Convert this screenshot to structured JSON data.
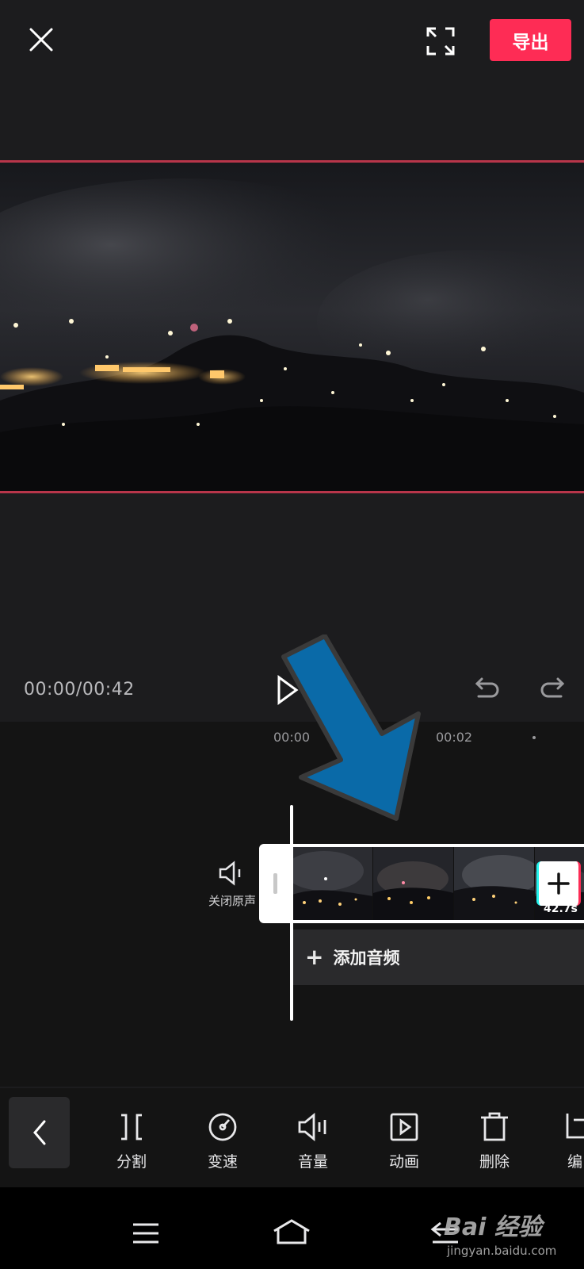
{
  "header": {
    "export_label": "导出"
  },
  "player": {
    "time_readout": "00:00/00:42"
  },
  "timeline": {
    "ruler": [
      "00:00",
      "00:02"
    ],
    "mute_label": "关闭原声",
    "clip_duration": "42.7s",
    "add_audio_label": "添加音频"
  },
  "toolbar": {
    "items": [
      {
        "icon": "split-icon",
        "label": "分割"
      },
      {
        "icon": "speed-icon",
        "label": "变速"
      },
      {
        "icon": "volume-icon",
        "label": "音量"
      },
      {
        "icon": "animation-icon",
        "label": "动画"
      },
      {
        "icon": "delete-icon",
        "label": "删除"
      },
      {
        "icon": "edit-icon",
        "label": "编"
      }
    ]
  },
  "watermark": {
    "logo": "Bai 经验",
    "site": "jingyan.baidu.com"
  },
  "colors": {
    "accent": "#fe2c55",
    "background": "#1c1c1e",
    "arrow": "#0a6aa8"
  }
}
